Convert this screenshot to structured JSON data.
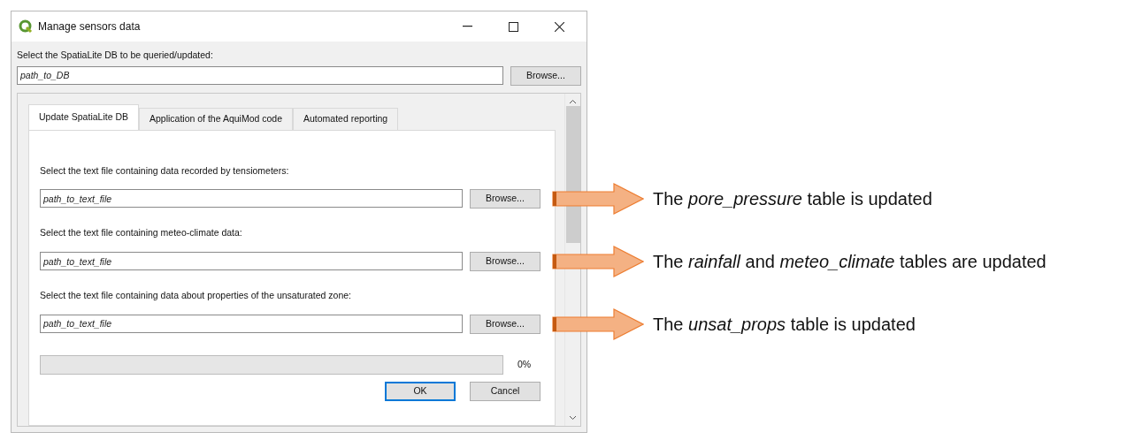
{
  "window": {
    "title": "Manage sensors data"
  },
  "db": {
    "label": "Select the SpatiaLite DB to be queried/updated:",
    "value": "path_to_DB",
    "button": "Browse..."
  },
  "tabs": [
    {
      "label": "Update SpatiaLite DB",
      "selected": true
    },
    {
      "label": "Application of the AquiMod code",
      "selected": false
    },
    {
      "label": "Automated reporting",
      "selected": false
    }
  ],
  "files": [
    {
      "label": "Select the text file containing data recorded by tensiometers:",
      "value": "path_to_text_file",
      "button": "Browse...",
      "annotation": "The *pore_pressure* table is updated"
    },
    {
      "label": "Select the text file containing meteo-climate data:",
      "value": "path_to_text_file",
      "button": "Browse...",
      "annotation": "The *rainfall* and *meteo_climate* tables are updated"
    },
    {
      "label": "Select the text file containing data about properties of the unsaturated zone:",
      "value": "path_to_text_file",
      "button": "Browse...",
      "annotation": "The *unsat_props* table is updated"
    }
  ],
  "progress": {
    "level": 0,
    "reading": "0%"
  },
  "buttons": [
    {
      "label": "OK",
      "default": true
    },
    {
      "label": "Cancel",
      "default": false
    }
  ]
}
